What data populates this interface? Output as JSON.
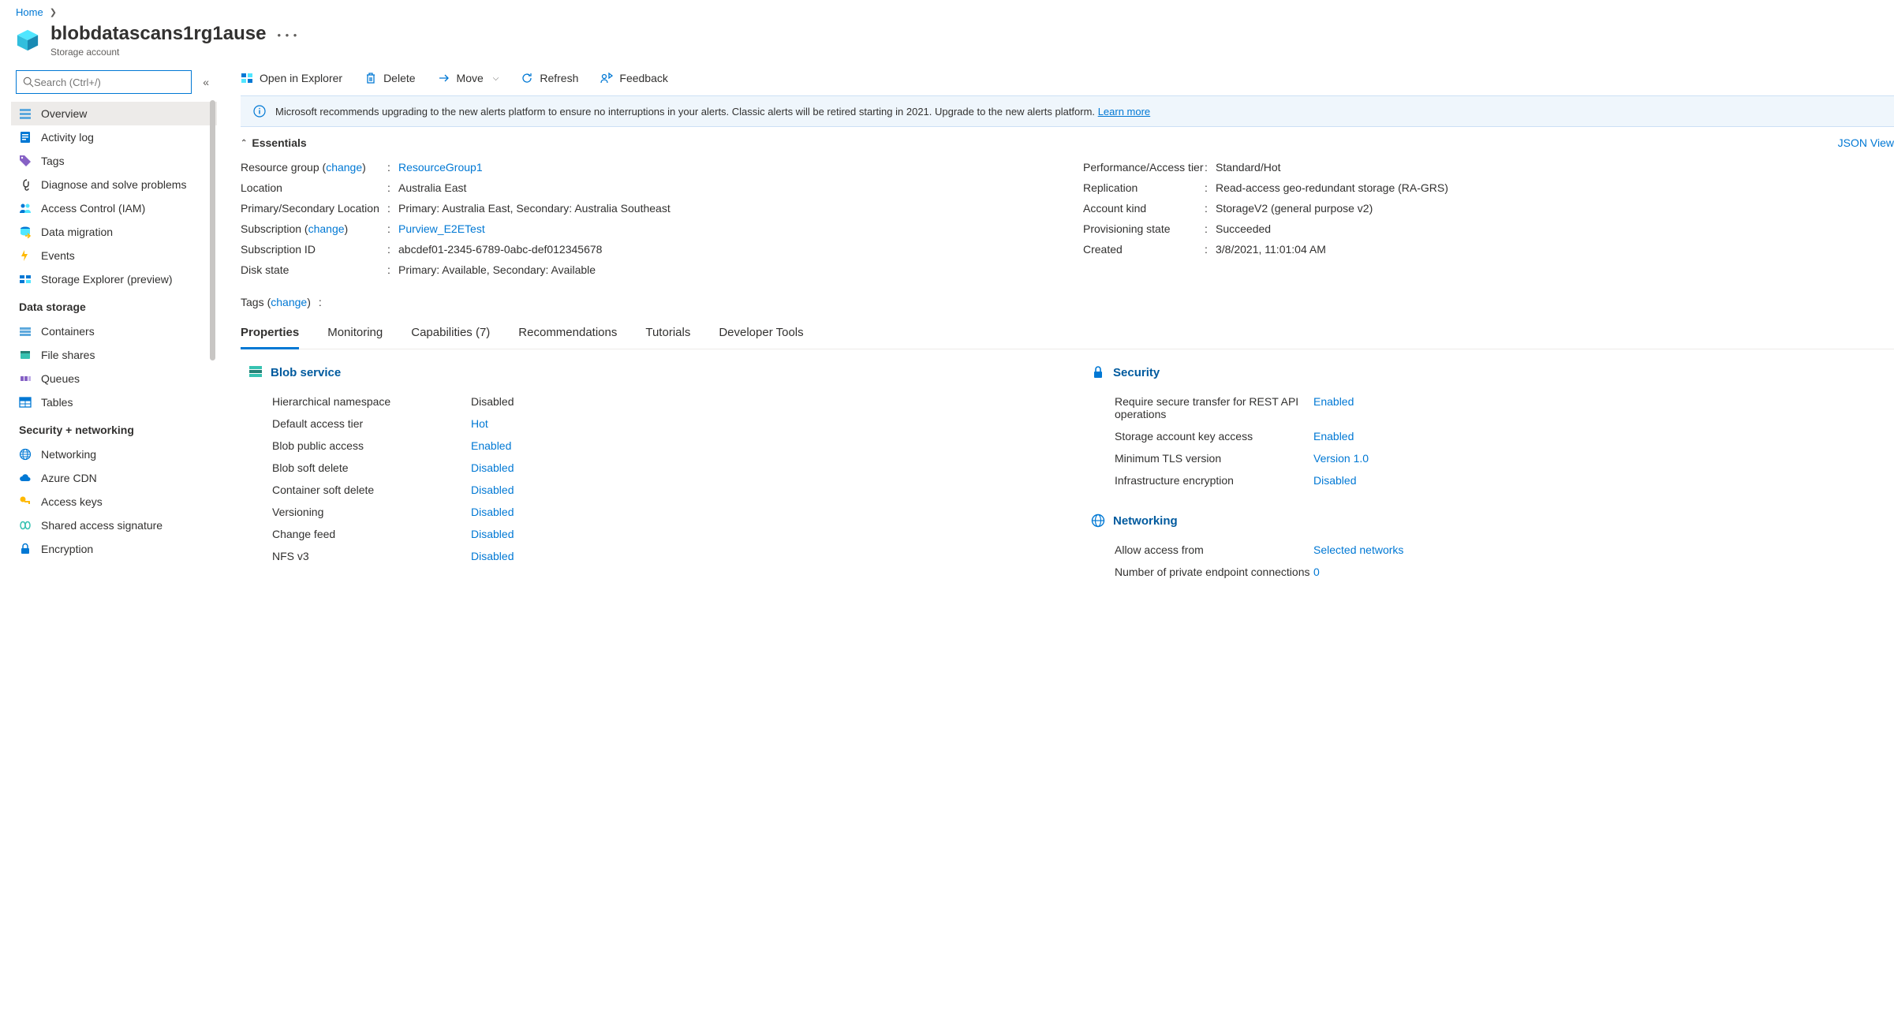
{
  "breadcrumb": {
    "home": "Home"
  },
  "header": {
    "title": "blobdatascans1rg1ause",
    "subtitle": "Storage account"
  },
  "search": {
    "placeholder": "Search (Ctrl+/)"
  },
  "nav": {
    "items_main": [
      {
        "label": "Overview",
        "icon": "overview"
      },
      {
        "label": "Activity log",
        "icon": "activity"
      },
      {
        "label": "Tags",
        "icon": "tags"
      },
      {
        "label": "Diagnose and solve problems",
        "icon": "diagnose"
      },
      {
        "label": "Access Control (IAM)",
        "icon": "iam"
      },
      {
        "label": "Data migration",
        "icon": "migration"
      },
      {
        "label": "Events",
        "icon": "events"
      },
      {
        "label": "Storage Explorer (preview)",
        "icon": "explorer"
      }
    ],
    "section_data": "Data storage",
    "items_data": [
      {
        "label": "Containers",
        "icon": "containers"
      },
      {
        "label": "File shares",
        "icon": "fileshares"
      },
      {
        "label": "Queues",
        "icon": "queues"
      },
      {
        "label": "Tables",
        "icon": "tables"
      }
    ],
    "section_sec": "Security + networking",
    "items_sec": [
      {
        "label": "Networking",
        "icon": "networking"
      },
      {
        "label": "Azure CDN",
        "icon": "cdn"
      },
      {
        "label": "Access keys",
        "icon": "keys"
      },
      {
        "label": "Shared access signature",
        "icon": "sas"
      },
      {
        "label": "Encryption",
        "icon": "encryption"
      }
    ]
  },
  "toolbar": {
    "open_explorer": "Open in Explorer",
    "delete": "Delete",
    "move": "Move",
    "refresh": "Refresh",
    "feedback": "Feedback"
  },
  "banner": {
    "text": "Microsoft recommends upgrading to the new alerts platform to ensure no interruptions in your alerts. Classic alerts will be retired starting in 2021. Upgrade to the new alerts platform.",
    "link": "Learn more"
  },
  "essentials": {
    "title": "Essentials",
    "json_view": "JSON View",
    "change": "change",
    "left": {
      "resource_group": {
        "label": "Resource group",
        "value": "ResourceGroup1"
      },
      "location": {
        "label": "Location",
        "value": "Australia East"
      },
      "primary_secondary": {
        "label": "Primary/Secondary Location",
        "value": "Primary: Australia East, Secondary: Australia Southeast"
      },
      "subscription": {
        "label": "Subscription",
        "value": "Purview_E2ETest"
      },
      "subscription_id": {
        "label": "Subscription ID",
        "value": "abcdef01-2345-6789-0abc-def012345678"
      },
      "disk_state": {
        "label": "Disk state",
        "value": "Primary: Available, Secondary: Available"
      }
    },
    "right": {
      "perf": {
        "label": "Performance/Access tier",
        "value": "Standard/Hot"
      },
      "replication": {
        "label": "Replication",
        "value": "Read-access geo-redundant storage (RA-GRS)"
      },
      "account_kind": {
        "label": "Account kind",
        "value": "StorageV2 (general purpose v2)"
      },
      "provisioning": {
        "label": "Provisioning state",
        "value": "Succeeded"
      },
      "created": {
        "label": "Created",
        "value": "3/8/2021, 11:01:04 AM"
      }
    },
    "tags_label": "Tags"
  },
  "tabs": {
    "properties": "Properties",
    "monitoring": "Monitoring",
    "capabilities": "Capabilities (7)",
    "recommendations": "Recommendations",
    "tutorials": "Tutorials",
    "developer": "Developer Tools"
  },
  "props": {
    "blob": {
      "title": "Blob service",
      "rows": [
        {
          "label": "Hierarchical namespace",
          "value": "Disabled",
          "link": false
        },
        {
          "label": "Default access tier",
          "value": "Hot",
          "link": true
        },
        {
          "label": "Blob public access",
          "value": "Enabled",
          "link": true
        },
        {
          "label": "Blob soft delete",
          "value": "Disabled",
          "link": true
        },
        {
          "label": "Container soft delete",
          "value": "Disabled",
          "link": true
        },
        {
          "label": "Versioning",
          "value": "Disabled",
          "link": true
        },
        {
          "label": "Change feed",
          "value": "Disabled",
          "link": true
        },
        {
          "label": "NFS v3",
          "value": "Disabled",
          "link": true
        }
      ]
    },
    "security": {
      "title": "Security",
      "rows": [
        {
          "label": "Require secure transfer for REST API operations",
          "value": "Enabled",
          "link": true
        },
        {
          "label": "Storage account key access",
          "value": "Enabled",
          "link": true
        },
        {
          "label": "Minimum TLS version",
          "value": "Version 1.0",
          "link": true
        },
        {
          "label": "Infrastructure encryption",
          "value": "Disabled",
          "link": true
        }
      ]
    },
    "networking": {
      "title": "Networking",
      "rows": [
        {
          "label": "Allow access from",
          "value": "Selected networks",
          "link": true
        },
        {
          "label": "Number of private endpoint connections",
          "value": "0",
          "link": true
        }
      ]
    }
  }
}
